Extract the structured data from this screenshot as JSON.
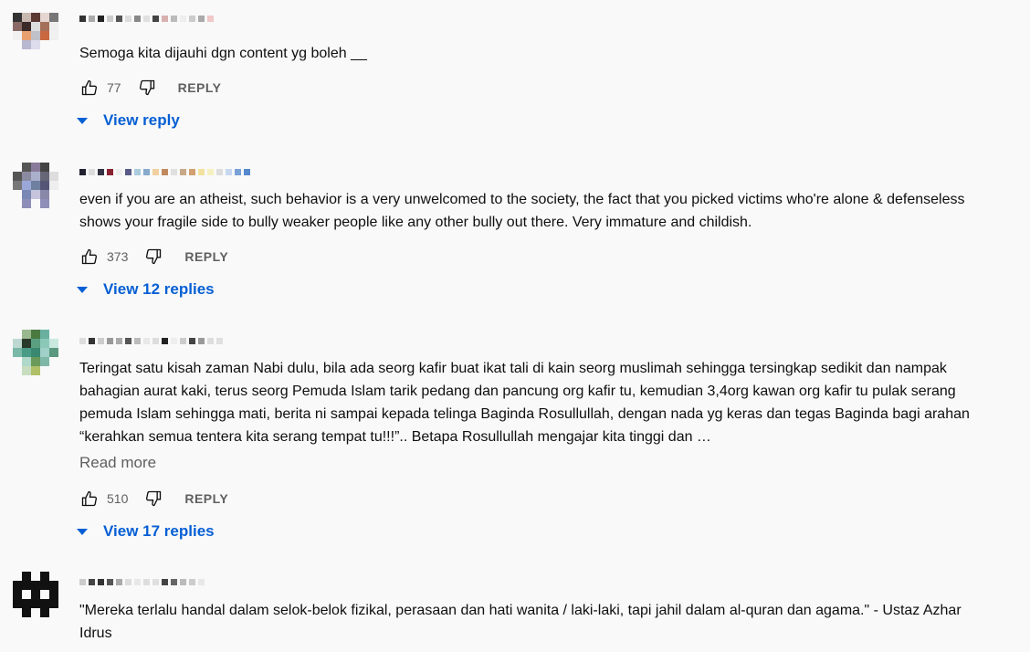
{
  "ui": {
    "reply_label": "REPLY",
    "read_more": "Read more"
  },
  "comments": [
    {
      "text": "Semoga kita dijauhi dgn content yg boleh __",
      "likes": "77",
      "replies_label": "View reply"
    },
    {
      "text": "even if you are an atheist, such behavior is a very unwelcomed to the society, the fact that you picked victims who're alone & defenseless shows your fragile side to bully weaker people like any other bully out there. Very immature and childish.",
      "likes": "373",
      "replies_label": "View 12 replies"
    },
    {
      "text": "Teringat satu kisah zaman Nabi dulu, bila ada seorg kafir buat ikat tali di kain seorg muslimah sehingga tersingkap sedikit dan nampak bahagian aurat kaki, terus seorg Pemuda Islam tarik pedang dan pancung org kafir tu, kemudian 3,4org kawan org kafir tu pulak serang pemuda Islam sehingga mati, berita ni sampai kepada telinga Baginda Rosullullah, dengan nada yg keras dan tegas Baginda bagi arahan “kerahkan semua tentera kita serang tempat tu!!!”.. Betapa Rosullullah mengajar kita tinggi dan …",
      "likes": "510",
      "replies_label": "View 17 replies"
    },
    {
      "text": "\"Mereka terlalu handal dalam selok-belok fizikal, perasaan dan hati wanita / laki-laki, tapi jahil dalam al-quran dan agama.\" - Ustaz Azhar Idrus"
    }
  ],
  "colors": {
    "link": "#065fd4",
    "meta": "#606060",
    "background": "#f9f9f9"
  },
  "icons": [
    "thumb-up-icon",
    "thumb-down-icon",
    "caret-down-icon"
  ]
}
